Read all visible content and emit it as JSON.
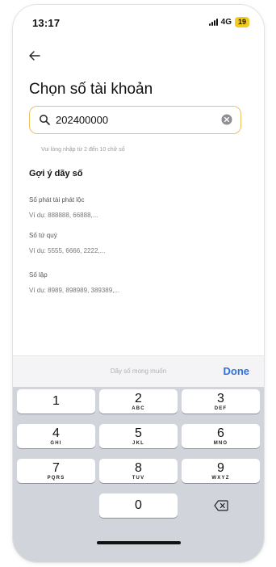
{
  "status": {
    "time": "13:17",
    "network": "4G",
    "battery": "19"
  },
  "header": {
    "title": "Chọn số tài khoản"
  },
  "search": {
    "value": "202400000",
    "hint": "Vui lòng nhập từ 2 đến 10 chữ số"
  },
  "suggestions": {
    "title": "Gợi ý dãy số",
    "items": [
      {
        "name": "Số phát tài phát lộc",
        "example": "Ví dụ: 888888, 66888,..."
      },
      {
        "name": "Số tứ quý",
        "example": "Ví dụ: 5555, 6666, 2222,..."
      },
      {
        "name": "Số lặp",
        "example": "Ví dụ: 8989, 898989, 389389,..."
      }
    ]
  },
  "keyboard": {
    "placeholder": "Dãy số mong muốn",
    "done_label": "Done",
    "keys": [
      {
        "digit": "1",
        "letters": ""
      },
      {
        "digit": "2",
        "letters": "ABC"
      },
      {
        "digit": "3",
        "letters": "DEF"
      },
      {
        "digit": "4",
        "letters": "GHI"
      },
      {
        "digit": "5",
        "letters": "JKL"
      },
      {
        "digit": "6",
        "letters": "MNO"
      },
      {
        "digit": "7",
        "letters": "PQRS"
      },
      {
        "digit": "8",
        "letters": "TUV"
      },
      {
        "digit": "9",
        "letters": "WXYZ"
      },
      {
        "digit": "0",
        "letters": ""
      }
    ]
  },
  "icons": {
    "back": "arrow-left-icon",
    "search": "search-icon",
    "clear": "clear-circle-icon",
    "delete": "backspace-icon"
  },
  "colors": {
    "accent_border": "#e9c45a",
    "battery": "#f2cc1d",
    "done": "#2f6fe0",
    "keyboard_bg": "#d1d4da"
  }
}
